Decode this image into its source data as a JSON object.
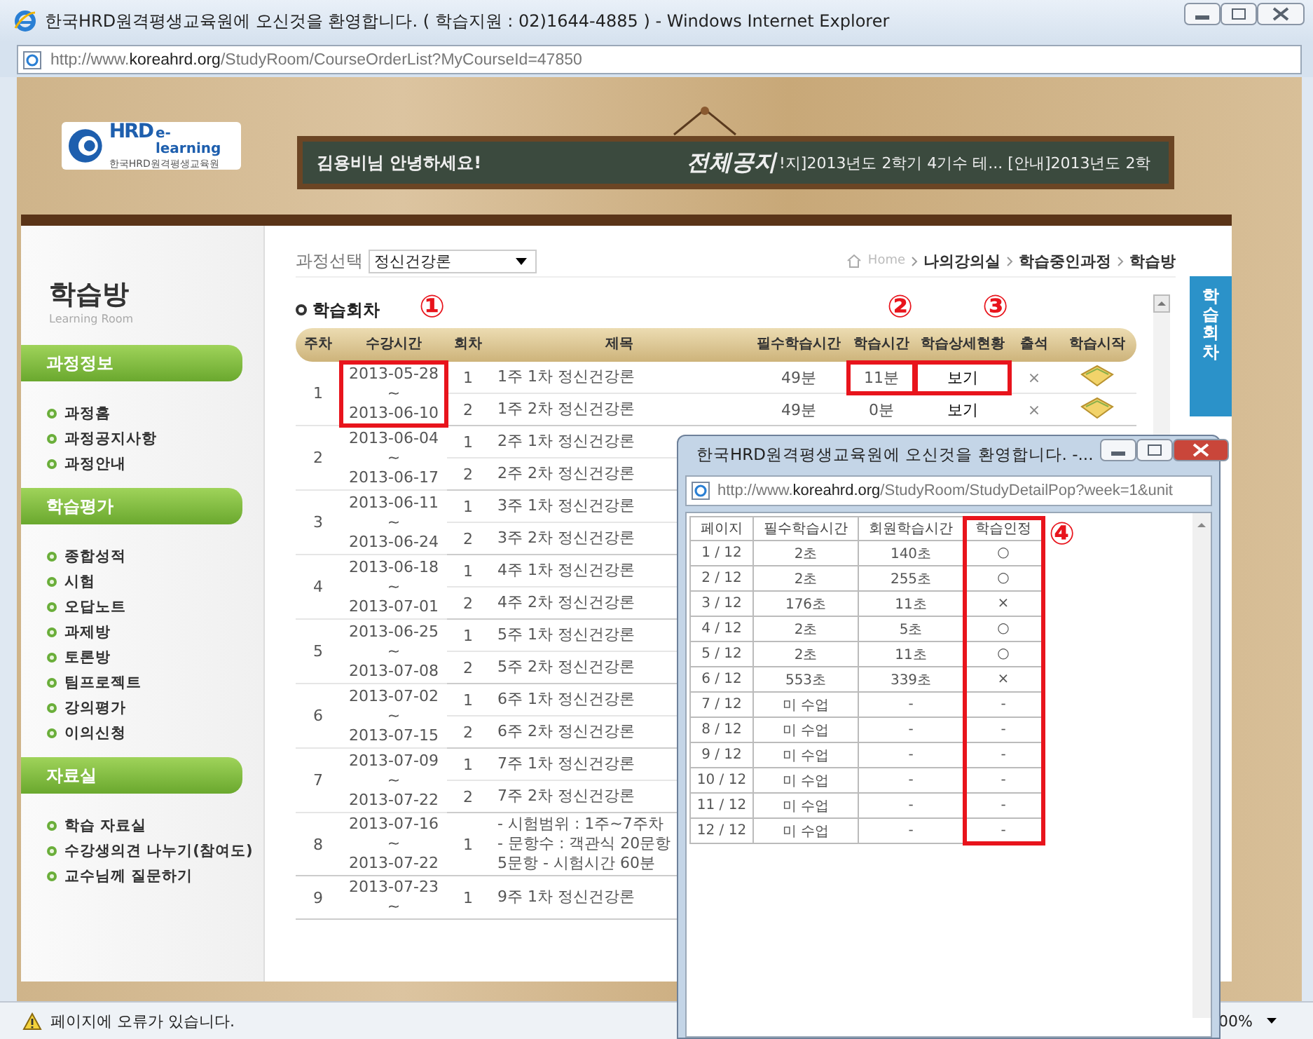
{
  "window": {
    "title": "한국HRD원격평생교육원에 오신것을 환영합니다. ( 학습지원 : 02)1644-4885 ) - Windows Internet Explorer",
    "address": "http://www.**koreahrd.org**/StudyRoom/CourseOrderList?MyCourseId=47850",
    "status": "페이지에 오류가 있습니다.",
    "zoom": "00%"
  },
  "header": {
    "logo_brand": "HRD",
    "logo_tag": "e-learning",
    "logo_name": "한국HRD원격평생교육원",
    "greeting": "김용비님 안녕하세요!",
    "notice_label": "전체공지",
    "notice_ticker": "!지]2013년도 2학기 4기수 테...   [안내]2013년도 2학"
  },
  "sidebar": {
    "title": "학습방",
    "subtitle": "Learning Room",
    "sections": [
      {
        "label": "과정정보",
        "items": [
          "과정홈",
          "과정공지사항",
          "과정안내"
        ]
      },
      {
        "label": "학습평가",
        "items": [
          "종합성적",
          "시험",
          "오답노트",
          "과제방",
          "토론방",
          "팀프로젝트",
          "강의평가",
          "이의신청"
        ]
      },
      {
        "label": "자료실",
        "items": [
          "학습 자료실",
          "수강생의견 나누기(참여도)",
          "교수님께 질문하기"
        ]
      }
    ]
  },
  "course_select": {
    "label": "과정선택",
    "value": "정신건강론"
  },
  "breadcrumb": [
    "Home",
    "나의강의실",
    "학습중인과정",
    "학습방"
  ],
  "side_tab": "학습회차",
  "section_title": "학습회차",
  "table": {
    "columns": [
      "주차",
      "수강시간",
      "회차",
      "제목",
      "필수학습시간",
      "학습시간",
      "학습상세현황",
      "출석",
      "학습시작"
    ],
    "weeks": [
      {
        "week": "1",
        "start": "2013-05-28",
        "sep": "~",
        "end": "2013-06-10",
        "sessions": [
          {
            "round": "1",
            "title": "1주 1차 정신건강론",
            "required": "49분",
            "studied": "11분",
            "detail": "보기",
            "attendance": "×"
          },
          {
            "round": "2",
            "title": "1주 2차 정신건강론",
            "required": "49분",
            "studied": "0분",
            "detail": "보기",
            "attendance": "×"
          }
        ]
      },
      {
        "week": "2",
        "start": "2013-06-04",
        "sep": "~",
        "end": "2013-06-17",
        "sessions": [
          {
            "round": "1",
            "title": "2주 1차 정신건강론"
          },
          {
            "round": "2",
            "title": "2주 2차 정신건강론"
          }
        ]
      },
      {
        "week": "3",
        "start": "2013-06-11",
        "sep": "~",
        "end": "2013-06-24",
        "sessions": [
          {
            "round": "1",
            "title": "3주 1차 정신건강론"
          },
          {
            "round": "2",
            "title": "3주 2차 정신건강론"
          }
        ]
      },
      {
        "week": "4",
        "start": "2013-06-18",
        "sep": "~",
        "end": "2013-07-01",
        "sessions": [
          {
            "round": "1",
            "title": "4주 1차 정신건강론"
          },
          {
            "round": "2",
            "title": "4주 2차 정신건강론"
          }
        ]
      },
      {
        "week": "5",
        "start": "2013-06-25",
        "sep": "~",
        "end": "2013-07-08",
        "sessions": [
          {
            "round": "1",
            "title": "5주 1차 정신건강론"
          },
          {
            "round": "2",
            "title": "5주 2차 정신건강론"
          }
        ]
      },
      {
        "week": "6",
        "start": "2013-07-02",
        "sep": "~",
        "end": "2013-07-15",
        "sessions": [
          {
            "round": "1",
            "title": "6주 1차 정신건강론"
          },
          {
            "round": "2",
            "title": "6주 2차 정신건강론"
          }
        ]
      },
      {
        "week": "7",
        "start": "2013-07-09",
        "sep": "~",
        "end": "2013-07-22",
        "sessions": [
          {
            "round": "1",
            "title": "7주 1차 정신건강론"
          },
          {
            "round": "2",
            "title": "7주 2차 정신건강론"
          }
        ]
      },
      {
        "week": "8",
        "start": "2013-07-16",
        "sep": "~",
        "end": "2013-07-22",
        "sessions": [
          {
            "round": "1",
            "title": "- 시험범위 : 1주~7주차\n- 문항수 : 객관식 20문항\n5문항 - 시험시간 60분"
          }
        ]
      },
      {
        "week": "9",
        "start": "2013-07-23",
        "sep": "~",
        "sessions": [
          {
            "round": "1",
            "title": "9주 1차 정신건강론"
          }
        ]
      }
    ]
  },
  "popup": {
    "title": "한국HRD원격평생교육원에 오신것을 환영합니다. -...",
    "address": "http://www.**koreahrd.org**/StudyRoom/StudyDetailPop?week=1&unit",
    "columns": [
      "페이지",
      "필수학습시간",
      "회원학습시간",
      "학습인정"
    ],
    "rows": [
      [
        "1 / 12",
        "2초",
        "140초",
        "○"
      ],
      [
        "2 / 12",
        "2초",
        "255초",
        "○"
      ],
      [
        "3 / 12",
        "176초",
        "11초",
        "×"
      ],
      [
        "4 / 12",
        "2초",
        "5초",
        "○"
      ],
      [
        "5 / 12",
        "2초",
        "11초",
        "○"
      ],
      [
        "6 / 12",
        "553초",
        "339초",
        "×"
      ],
      [
        "7 / 12",
        "미 수업",
        "-",
        "-"
      ],
      [
        "8 / 12",
        "미 수업",
        "-",
        "-"
      ],
      [
        "9 / 12",
        "미 수업",
        "-",
        "-"
      ],
      [
        "10 / 12",
        "미 수업",
        "-",
        "-"
      ],
      [
        "11 / 12",
        "미 수업",
        "-",
        "-"
      ],
      [
        "12 / 12",
        "미 수업",
        "-",
        "-"
      ]
    ]
  },
  "annotations": [
    {
      "label": "①",
      "kind": "dates"
    },
    {
      "label": "②",
      "kind": "studied"
    },
    {
      "label": "③",
      "kind": "detail"
    },
    {
      "label": "④",
      "kind": "recognized"
    }
  ]
}
